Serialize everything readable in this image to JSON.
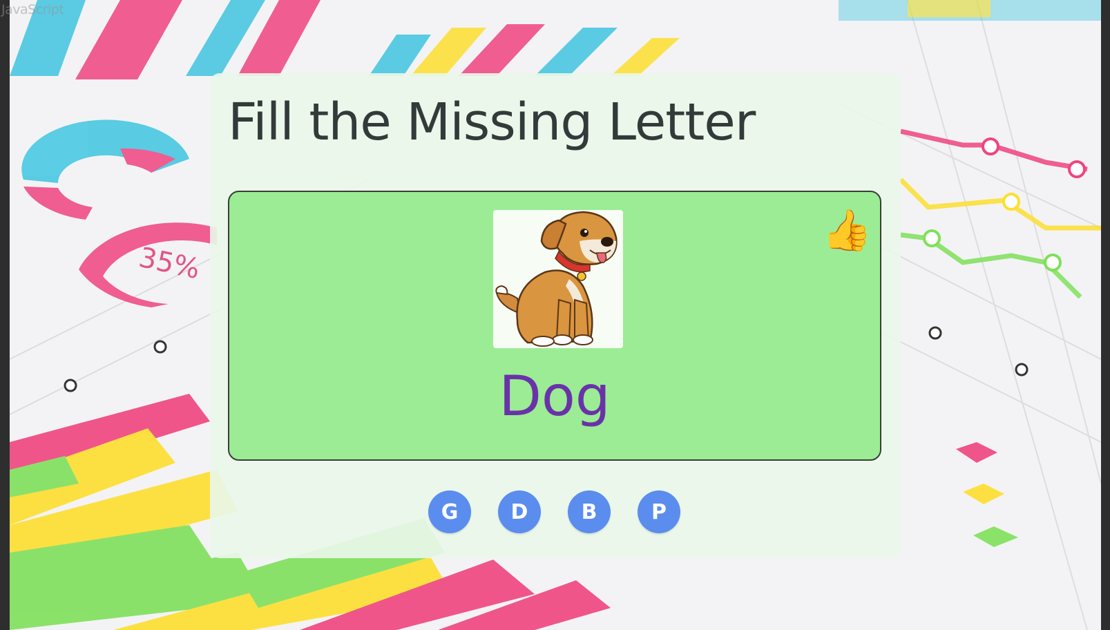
{
  "page_leak_text": "JavaScript",
  "game": {
    "title": "Fill the Missing Letter",
    "word": "Dog",
    "picture_icon": "dog-picture",
    "feedback_icon": "thumbs-up-icon",
    "feedback_glyph": "👍",
    "options": [
      "G",
      "D",
      "B",
      "P"
    ]
  },
  "colors": {
    "panel": "#9bec95",
    "word": "#6a32a8",
    "option_button": "#5a8dee",
    "feedback": "#f2b632"
  }
}
